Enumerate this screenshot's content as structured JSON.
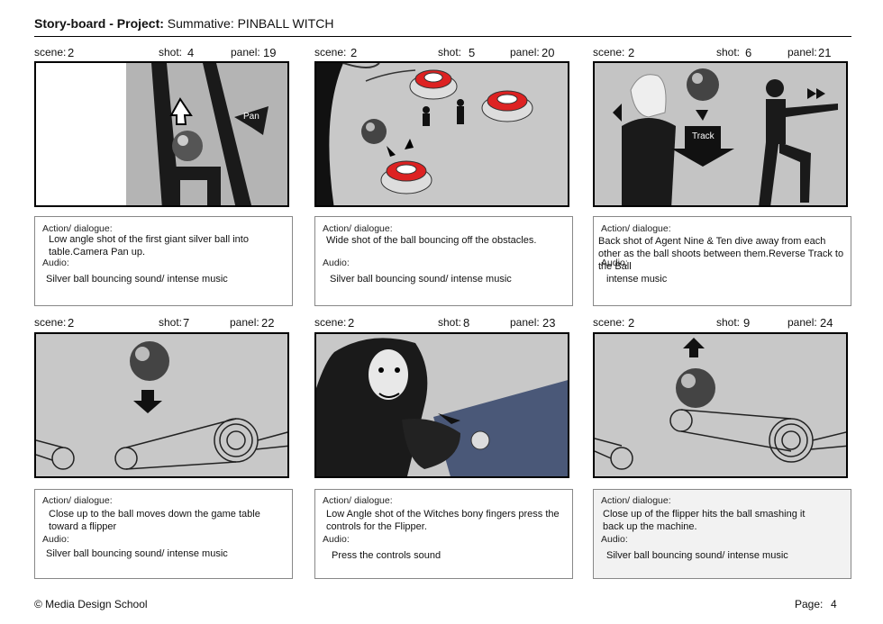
{
  "header": {
    "prefix": "Story-board - Project:",
    "project": "Summative: PINBALL WITCH"
  },
  "labels": {
    "scene": "scene:",
    "shot": "shot:",
    "panel": "panel:",
    "action": "Action/ dialogue:",
    "audio": "Audio:"
  },
  "panels": [
    {
      "scene": "2",
      "shot": "4",
      "panel": "19",
      "action": "Low angle shot of the first giant silver ball into table.Camera Pan up.",
      "audio": "Silver ball bouncing sound/ intense music",
      "arrow_label": "Pan"
    },
    {
      "scene": "2",
      "shot": "5",
      "panel": "20",
      "action": "Wide shot of the ball bouncing off the obstacles.",
      "audio": "Silver ball bouncing sound/ intense music"
    },
    {
      "scene": "2",
      "shot": "6",
      "panel": "21",
      "action": "Back shot of Agent Nine & Ten dive away from each other as the ball shoots between them.Reverse Track to the Ball",
      "audio": "intense music",
      "arrow_label": "Track"
    },
    {
      "scene": "2",
      "shot": "7",
      "panel": "22",
      "action": "Close up to the ball moves down the game table toward a flipper",
      "audio": "Silver ball bouncing sound/ intense music"
    },
    {
      "scene": "2",
      "shot": "8",
      "panel": "23",
      "action": "Low Angle shot of the Witches bony fingers press the controls for the Flipper.",
      "audio": "Press the controls sound"
    },
    {
      "scene": "2",
      "shot": "9",
      "panel": "24",
      "action": "Close up of the flipper hits the ball smashing it back up the machine.",
      "audio": "Silver ball bouncing sound/ intense music"
    }
  ],
  "footer": {
    "copyright": "© Media Design School",
    "page_label": "Page:",
    "page_number": "4"
  }
}
